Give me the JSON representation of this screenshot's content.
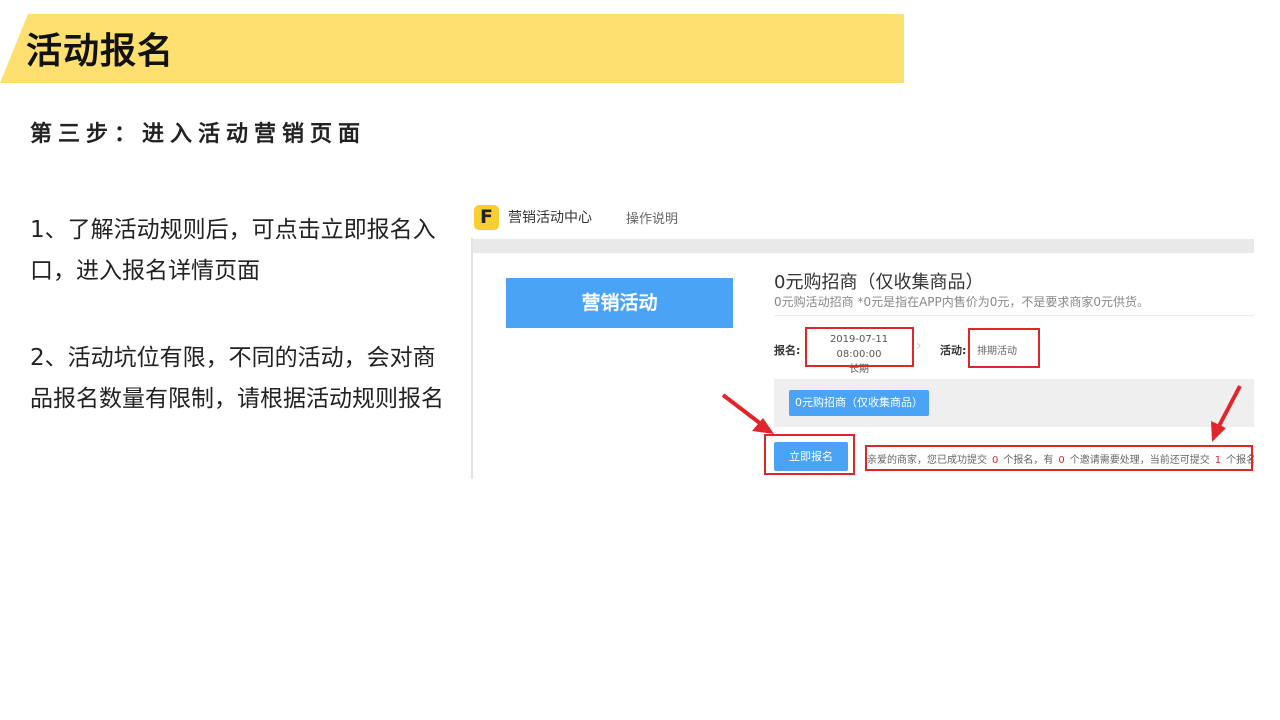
{
  "slide": {
    "title": "活动报名",
    "step": "第三步：进入活动营销页面",
    "paragraph1": "1、了解活动规则后，可点击立即报名入口，进入报名详情页面",
    "paragraph2": "2、活动坑位有限，不同的活动，会对商品报名数量有限制，请根据活动规则报名"
  },
  "screenshot": {
    "logo_letter": "F",
    "center_name": "营销活动中心",
    "help_link": "操作说明",
    "menu_button": "营销活动",
    "activity": {
      "title": "0元购招商（仅收集商品）",
      "description": "0元购活动招商 *0元是指在APP内售价为0元，不是要求商家0元供货。",
      "signup_label": "报名:",
      "signup_time": "2019-07-11 08:00:00",
      "signup_duration": "长期",
      "activity_label": "活动:",
      "activity_phase": "排期活动",
      "tab_label": "0元购招商（仅收集商品）",
      "signup_button": "立即报名"
    },
    "notice": {
      "part1": "亲爱的商家，您已成功提交",
      "submitted": "0",
      "part2": "个报名，有",
      "invites": "0",
      "part3": "个邀请需要处理，当前还可提交",
      "remaining": "1",
      "part4": "个报名"
    }
  },
  "colors": {
    "banner": "#fde06f",
    "accent_blue": "#4ba3f5",
    "highlight_red": "#e0262b",
    "logo_yellow": "#f8cf32"
  }
}
